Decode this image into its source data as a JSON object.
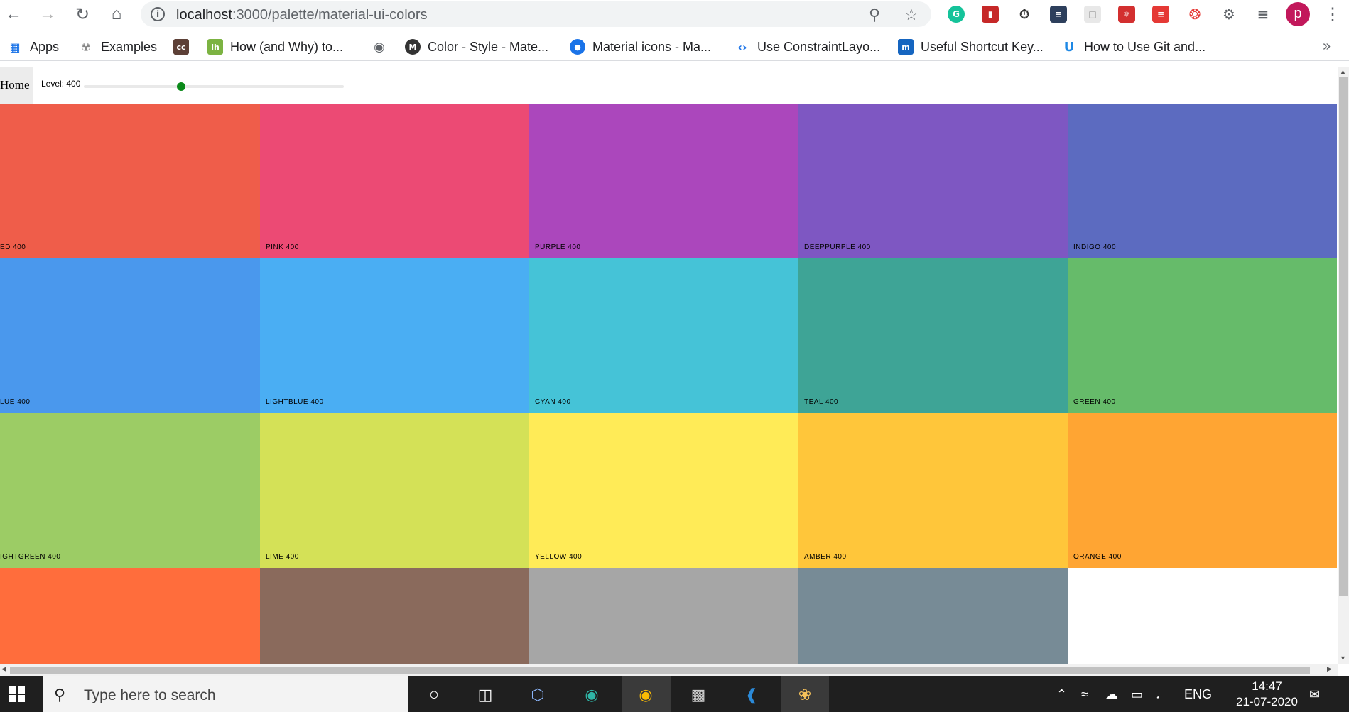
{
  "browser": {
    "url_host": "localhost",
    "url_path": ":3000/palette/material-ui-colors",
    "profile_initial": "p",
    "bookmarks": [
      {
        "label": "Apps",
        "icon": "apps-grid-icon"
      },
      {
        "label": "Examples",
        "icon": "examples-icon"
      },
      {
        "label": "",
        "icon": "cc-icon"
      },
      {
        "label": "How (and Why) to...",
        "icon": "lh-icon"
      },
      {
        "label": "",
        "icon": "globe-icon"
      },
      {
        "label": "Color - Style - Mate...",
        "icon": "material-icon"
      },
      {
        "label": "Material icons - Ma...",
        "icon": "material-icons-icon"
      },
      {
        "label": "Use ConstraintLayo...",
        "icon": "code-icon"
      },
      {
        "label": "Useful Shortcut Key...",
        "icon": "m-icon"
      },
      {
        "label": "How to Use Git and...",
        "icon": "u-icon"
      }
    ]
  },
  "navbar": {
    "home_label": "Home",
    "level_label": "Level: 400",
    "level": 400,
    "level_min": 100,
    "level_max": 900
  },
  "colors": {
    "slider_handle": "#0b8a1a",
    "boxes": [
      {
        "name": "ED 400",
        "color": "#ef5d4a"
      },
      {
        "name": "PINK 400",
        "color": "#ec4a74"
      },
      {
        "name": "PURPLE 400",
        "color": "#ab47bc"
      },
      {
        "name": "DEEPPURPLE 400",
        "color": "#7e57c2"
      },
      {
        "name": "INDIGO 400",
        "color": "#5c6bc0"
      },
      {
        "name": "LUE 400",
        "color": "#4a98ed"
      },
      {
        "name": "LIGHTBLUE 400",
        "color": "#4aaef3"
      },
      {
        "name": "CYAN 400",
        "color": "#45c3d7"
      },
      {
        "name": "TEAL 400",
        "color": "#3ea496"
      },
      {
        "name": "GREEN 400",
        "color": "#66bb6a"
      },
      {
        "name": "IGHTGREEN 400",
        "color": "#9ccc65"
      },
      {
        "name": "LIME 400",
        "color": "#d4e157"
      },
      {
        "name": "YELLOW 400",
        "color": "#ffeb57"
      },
      {
        "name": "AMBER 400",
        "color": "#ffc63a"
      },
      {
        "name": "ORANGE 400",
        "color": "#ffa533"
      },
      {
        "name": "",
        "color": "#ff6d3c"
      },
      {
        "name": "",
        "color": "#8a6a5c"
      },
      {
        "name": "",
        "color": "#a6a6a6"
      },
      {
        "name": "",
        "color": "#778b96"
      }
    ]
  },
  "taskbar": {
    "search_placeholder": "Type here to search",
    "language": "ENG",
    "time": "14:47",
    "date": "21-07-2020"
  }
}
